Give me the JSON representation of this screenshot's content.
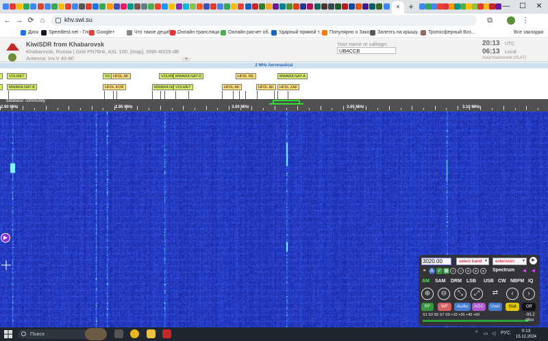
{
  "browser": {
    "url": "khv.swl.su",
    "active_tab_close": "×",
    "new_tab": "+",
    "nav": {
      "back": "←",
      "forward": "→",
      "reload": "⟳",
      "home": "⌂"
    },
    "window": {
      "minimize": "—",
      "maximize": "☐",
      "close": "✕"
    },
    "bookmarks": [
      {
        "label": "Диск",
        "color": "#1a73e8"
      },
      {
        "label": "Speedtest.net - Гло...",
        "color": "#141526"
      },
      {
        "label": "Google+",
        "color": "#db4437"
      },
      {
        "label": "Что такое децибел...",
        "color": "#888888"
      },
      {
        "label": "Онлайн трансляци...",
        "color": "#e53935"
      },
      {
        "label": "Онлайн расчет об...",
        "color": "#4caf50"
      },
      {
        "label": "Ударный прямой т...",
        "color": "#1565c0"
      },
      {
        "label": "Популярно о Зако...",
        "color": "#f57c00"
      },
      {
        "label": "Залезть на крышу...",
        "color": "#555555"
      },
      {
        "label": "Тропосферный Воз...",
        "color": "#8d6e63"
      }
    ],
    "all_bookmarks": "Все закладки"
  },
  "kiwi": {
    "title": "KiwiSDR from Khabarovsk",
    "location": "Khabarovsk, Russia | Grid PN78nk, ASL 100, [map], SNR 40/29 dB",
    "antenna": "Antenna: Inv.V 40-80",
    "callsign_label": "Your name or callsign:",
    "callsign_value": "UB4CCB",
    "utc_time": "20:13",
    "utc_label": "UTC",
    "local_time": "06:13",
    "local_label": "Local",
    "timezone": "Asia/Vladivostok (VLAT)",
    "band_name": "2 MHz Aeronautical",
    "database": "database: community",
    "freq_ticks": [
      "2.90 MHz",
      "2.95 MHz",
      "3.00 MHz",
      "3.05 MHz",
      "3.10 MHz"
    ]
  },
  "labels": [
    {
      "text": "VOLMET",
      "kind": "g"
    },
    {
      "text": "MWARA NAT-B",
      "kind": "g"
    },
    {
      "text": "VO",
      "kind": "g"
    },
    {
      "text": "HFDL AK",
      "kind": "y"
    },
    {
      "text": "HFDL KOR",
      "kind": "y"
    },
    {
      "text": "VOLME",
      "kind": "g"
    },
    {
      "text": "MWARA NAT-D",
      "kind": "g"
    },
    {
      "text": "MWARA NA",
      "kind": "g"
    },
    {
      "text": "VOLMET",
      "kind": "g"
    },
    {
      "text": "HFDL IRL",
      "kind": "y"
    },
    {
      "text": "HFDL AK",
      "kind": "y"
    },
    {
      "text": "MWARA NAT-A",
      "kind": "g"
    },
    {
      "text": "HFDL AK",
      "kind": "y"
    },
    {
      "text": "HFDL ZAF",
      "kind": "y"
    }
  ],
  "panel": {
    "frequency": "3020.00",
    "select_band": "select band",
    "extension": "extension",
    "play": "▶",
    "spectrum": "Spectrum",
    "modes": [
      "AM",
      "SAM",
      "DRM",
      "LSB",
      "USB",
      "CW",
      "NBFM",
      "IQ"
    ],
    "active_mode": "AM",
    "zoom_icons": [
      "⊕",
      "⊖",
      "⤡",
      "⤢",
      "⇄",
      "‹",
      "›"
    ],
    "toggles": [
      {
        "label": "RF",
        "color": "#3a9a3a"
      },
      {
        "label": "WF",
        "color": "#e06060"
      },
      {
        "label": "Audio",
        "color": "#4a7fd0"
      },
      {
        "label": "AGC",
        "color": "#b05bd0"
      },
      {
        "label": "User",
        "color": "#4a7fd0"
      },
      {
        "label": "Stat",
        "color": "#e8d000"
      },
      {
        "label": "Off",
        "color": "#111111"
      }
    ],
    "s_scale": "S1   S3   S5   S7   S9  +10 +20    +40    +60",
    "dbm_value": "-93.2",
    "dbm_label": "dBm"
  },
  "taskbar": {
    "search": "Поиск",
    "language": "РУС",
    "time": "0:13",
    "date": "15.12.2024"
  }
}
